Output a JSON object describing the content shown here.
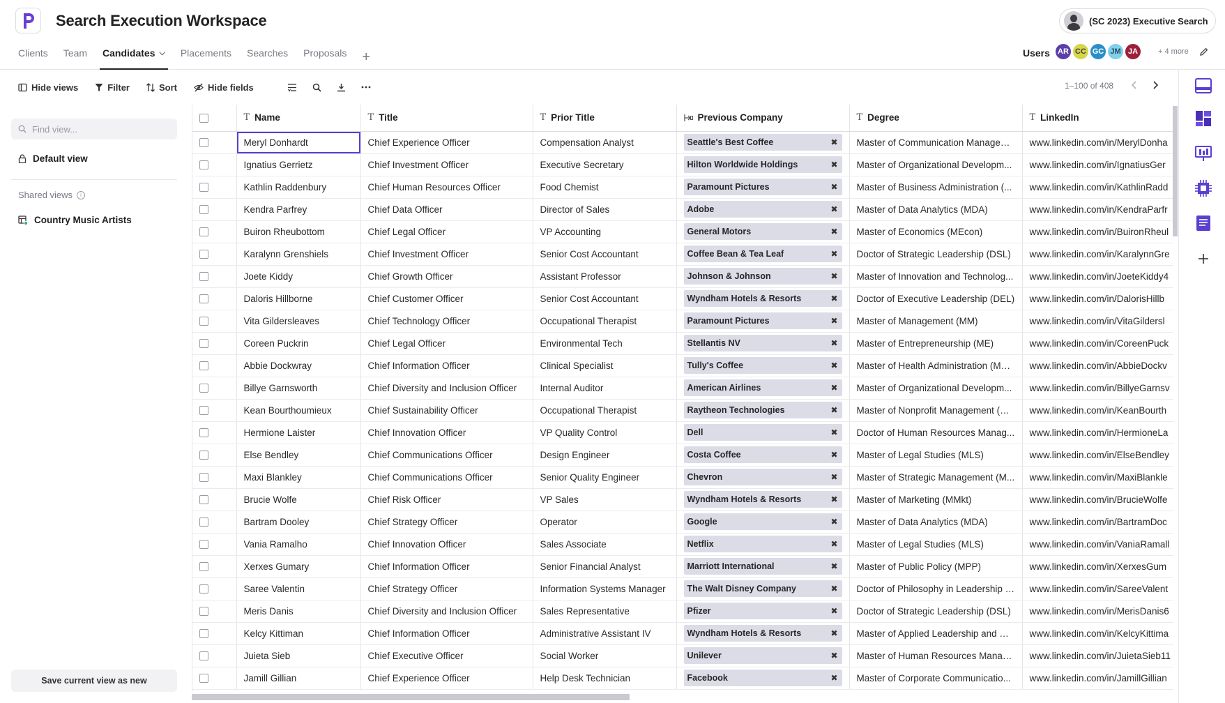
{
  "app": {
    "title": "Search Execution Workspace",
    "workspace_name": "(SC 2023) Executive Search",
    "accent": "#5a3fd1"
  },
  "nav": {
    "tabs": [
      {
        "label": "Clients"
      },
      {
        "label": "Team"
      },
      {
        "label": "Candidates"
      },
      {
        "label": "Placements"
      },
      {
        "label": "Searches"
      },
      {
        "label": "Proposals"
      }
    ],
    "active_tab": "Candidates",
    "add_icon": "+"
  },
  "users": {
    "label": "Users",
    "avatars": [
      {
        "initials": "AR",
        "color": "#5b3ea8",
        "text": "#ffffff"
      },
      {
        "initials": "CC",
        "color": "#d6d64a",
        "text": "#444444"
      },
      {
        "initials": "GC",
        "color": "#2a8fc9",
        "text": "#ffffff"
      },
      {
        "initials": "JM",
        "color": "#7fd0ea",
        "text": "#2a4c66"
      },
      {
        "initials": "JA",
        "color": "#9e1f3a",
        "text": "#ffffff"
      }
    ],
    "more": "+ 4 more"
  },
  "toolbar": {
    "hide_views": "Hide views",
    "filter": "Filter",
    "sort": "Sort",
    "hide_fields": "Hide fields",
    "pagination": "1–100 of 408"
  },
  "sidebar": {
    "search_placeholder": "Find view...",
    "default_view": "Default view",
    "shared_views_label": "Shared views",
    "shared_views": [
      "Country Music Artists"
    ],
    "save_button": "Save current view as new"
  },
  "grid": {
    "columns": [
      "Name",
      "Title",
      "Prior Title",
      "Previous Company",
      "Degree",
      "LinkedIn"
    ],
    "rows": [
      {
        "name": "Meryl Donhardt",
        "title": "Chief Experience Officer",
        "prior": "Compensation Analyst",
        "company": "Seattle's Best Coffee",
        "degree": "Master of Communication Managem...",
        "linkedin": "www.linkedin.com/in/MerylDonha"
      },
      {
        "name": "Ignatius Gerrietz",
        "title": "Chief Investment Officer",
        "prior": "Executive Secretary",
        "company": "Hilton Worldwide Holdings",
        "degree": "Master of Organizational Developm...",
        "linkedin": "www.linkedin.com/in/IgnatiusGer"
      },
      {
        "name": "Kathlin Raddenbury",
        "title": "Chief Human Resources Officer",
        "prior": "Food Chemist",
        "company": "Paramount Pictures",
        "degree": "Master of Business Administration (...",
        "linkedin": "www.linkedin.com/in/KathlinRadd"
      },
      {
        "name": "Kendra Parfrey",
        "title": "Chief Data Officer",
        "prior": "Director of Sales",
        "company": "Adobe",
        "degree": "Master of Data Analytics (MDA)",
        "linkedin": "www.linkedin.com/in/KendraParfr"
      },
      {
        "name": "Buiron Rheubottom",
        "title": "Chief Legal Officer",
        "prior": "VP Accounting",
        "company": "General Motors",
        "degree": "Master of Economics (MEcon)",
        "linkedin": "www.linkedin.com/in/BuironRheul"
      },
      {
        "name": "Karalynn Grenshiels",
        "title": "Chief Investment Officer",
        "prior": "Senior Cost Accountant",
        "company": "Coffee Bean & Tea Leaf",
        "degree": "Doctor of Strategic Leadership (DSL)",
        "linkedin": "www.linkedin.com/in/KaralynnGre"
      },
      {
        "name": "Joete Kiddy",
        "title": "Chief Growth Officer",
        "prior": "Assistant Professor",
        "company": "Johnson & Johnson",
        "degree": "Master of Innovation and Technolog...",
        "linkedin": "www.linkedin.com/in/JoeteKiddy4"
      },
      {
        "name": "Daloris Hillborne",
        "title": "Chief Customer Officer",
        "prior": "Senior Cost Accountant",
        "company": "Wyndham Hotels & Resorts",
        "degree": "Doctor of Executive Leadership (DEL)",
        "linkedin": "www.linkedin.com/in/DalorisHillb"
      },
      {
        "name": "Vita Gildersleaves",
        "title": "Chief Technology Officer",
        "prior": "Occupational Therapist",
        "company": "Paramount Pictures",
        "degree": "Master of Management (MM)",
        "linkedin": "www.linkedin.com/in/VitaGildersl"
      },
      {
        "name": "Coreen Puckrin",
        "title": "Chief Legal Officer",
        "prior": "Environmental Tech",
        "company": "Stellantis NV",
        "degree": "Master of Entrepreneurship (ME)",
        "linkedin": "www.linkedin.com/in/CoreenPuck"
      },
      {
        "name": "Abbie Dockwray",
        "title": "Chief Information Officer",
        "prior": "Clinical Specialist",
        "company": "Tully's Coffee",
        "degree": "Master of Health Administration (MH...",
        "linkedin": "www.linkedin.com/in/AbbieDockv"
      },
      {
        "name": "Billye Garnsworth",
        "title": "Chief Diversity and Inclusion Officer",
        "prior": "Internal Auditor",
        "company": "American Airlines",
        "degree": "Master of Organizational Developm...",
        "linkedin": "www.linkedin.com/in/BillyeGarnsv"
      },
      {
        "name": "Kean Bourthoumieux",
        "title": "Chief Sustainability Officer",
        "prior": "Occupational Therapist",
        "company": "Raytheon Technologies",
        "degree": "Master of Nonprofit Management (M...",
        "linkedin": "www.linkedin.com/in/KeanBourth"
      },
      {
        "name": "Hermione Laister",
        "title": "Chief Innovation Officer",
        "prior": "VP Quality Control",
        "company": "Dell",
        "degree": "Doctor of Human Resources Manag...",
        "linkedin": "www.linkedin.com/in/HermioneLa"
      },
      {
        "name": "Else Bendley",
        "title": "Chief Communications Officer",
        "prior": "Design Engineer",
        "company": "Costa Coffee",
        "degree": "Master of Legal Studies (MLS)",
        "linkedin": "www.linkedin.com/in/ElseBendley"
      },
      {
        "name": "Maxi Blankley",
        "title": "Chief Communications Officer",
        "prior": "Senior Quality Engineer",
        "company": "Chevron",
        "degree": "Master of Strategic Management (M...",
        "linkedin": "www.linkedin.com/in/MaxiBlankle"
      },
      {
        "name": "Brucie Wolfe",
        "title": "Chief Risk Officer",
        "prior": "VP Sales",
        "company": "Wyndham Hotels & Resorts",
        "degree": "Master of Marketing (MMkt)",
        "linkedin": "www.linkedin.com/in/BrucieWolfe"
      },
      {
        "name": "Bartram Dooley",
        "title": "Chief Strategy Officer",
        "prior": "Operator",
        "company": "Google",
        "degree": "Master of Data Analytics (MDA)",
        "linkedin": "www.linkedin.com/in/BartramDoc"
      },
      {
        "name": "Vania Ramalho",
        "title": "Chief Innovation Officer",
        "prior": "Sales Associate",
        "company": "Netflix",
        "degree": "Master of Legal Studies (MLS)",
        "linkedin": "www.linkedin.com/in/VaniaRamall"
      },
      {
        "name": "Xerxes Gumary",
        "title": "Chief Information Officer",
        "prior": "Senior Financial Analyst",
        "company": "Marriott International",
        "degree": "Master of Public Policy (MPP)",
        "linkedin": "www.linkedin.com/in/XerxesGum"
      },
      {
        "name": "Saree Valentin",
        "title": "Chief Strategy Officer",
        "prior": "Information Systems Manager",
        "company": "The Walt Disney Company",
        "degree": "Doctor of Philosophy in Leadership (...",
        "linkedin": "www.linkedin.com/in/SareeValent"
      },
      {
        "name": "Meris Danis",
        "title": "Chief Diversity and Inclusion Officer",
        "prior": "Sales Representative",
        "company": "Pfizer",
        "degree": "Doctor of Strategic Leadership (DSL)",
        "linkedin": "www.linkedin.com/in/MerisDanis6"
      },
      {
        "name": "Kelcy Kittiman",
        "title": "Chief Information Officer",
        "prior": "Administrative Assistant IV",
        "company": "Wyndham Hotels & Resorts",
        "degree": "Master of Applied Leadership and M...",
        "linkedin": "www.linkedin.com/in/KelcyKittima"
      },
      {
        "name": "Juieta Sieb",
        "title": "Chief Executive Officer",
        "prior": "Social Worker",
        "company": "Unilever",
        "degree": "Master of Human Resources Manage...",
        "linkedin": "www.linkedin.com/in/JuietaSieb11"
      },
      {
        "name": "Jamill Gillian",
        "title": "Chief Experience Officer",
        "prior": "Help Desk Technician",
        "company": "Facebook",
        "degree": "Master of Corporate Communicatio...",
        "linkedin": "www.linkedin.com/in/JamillGillian"
      }
    ]
  }
}
